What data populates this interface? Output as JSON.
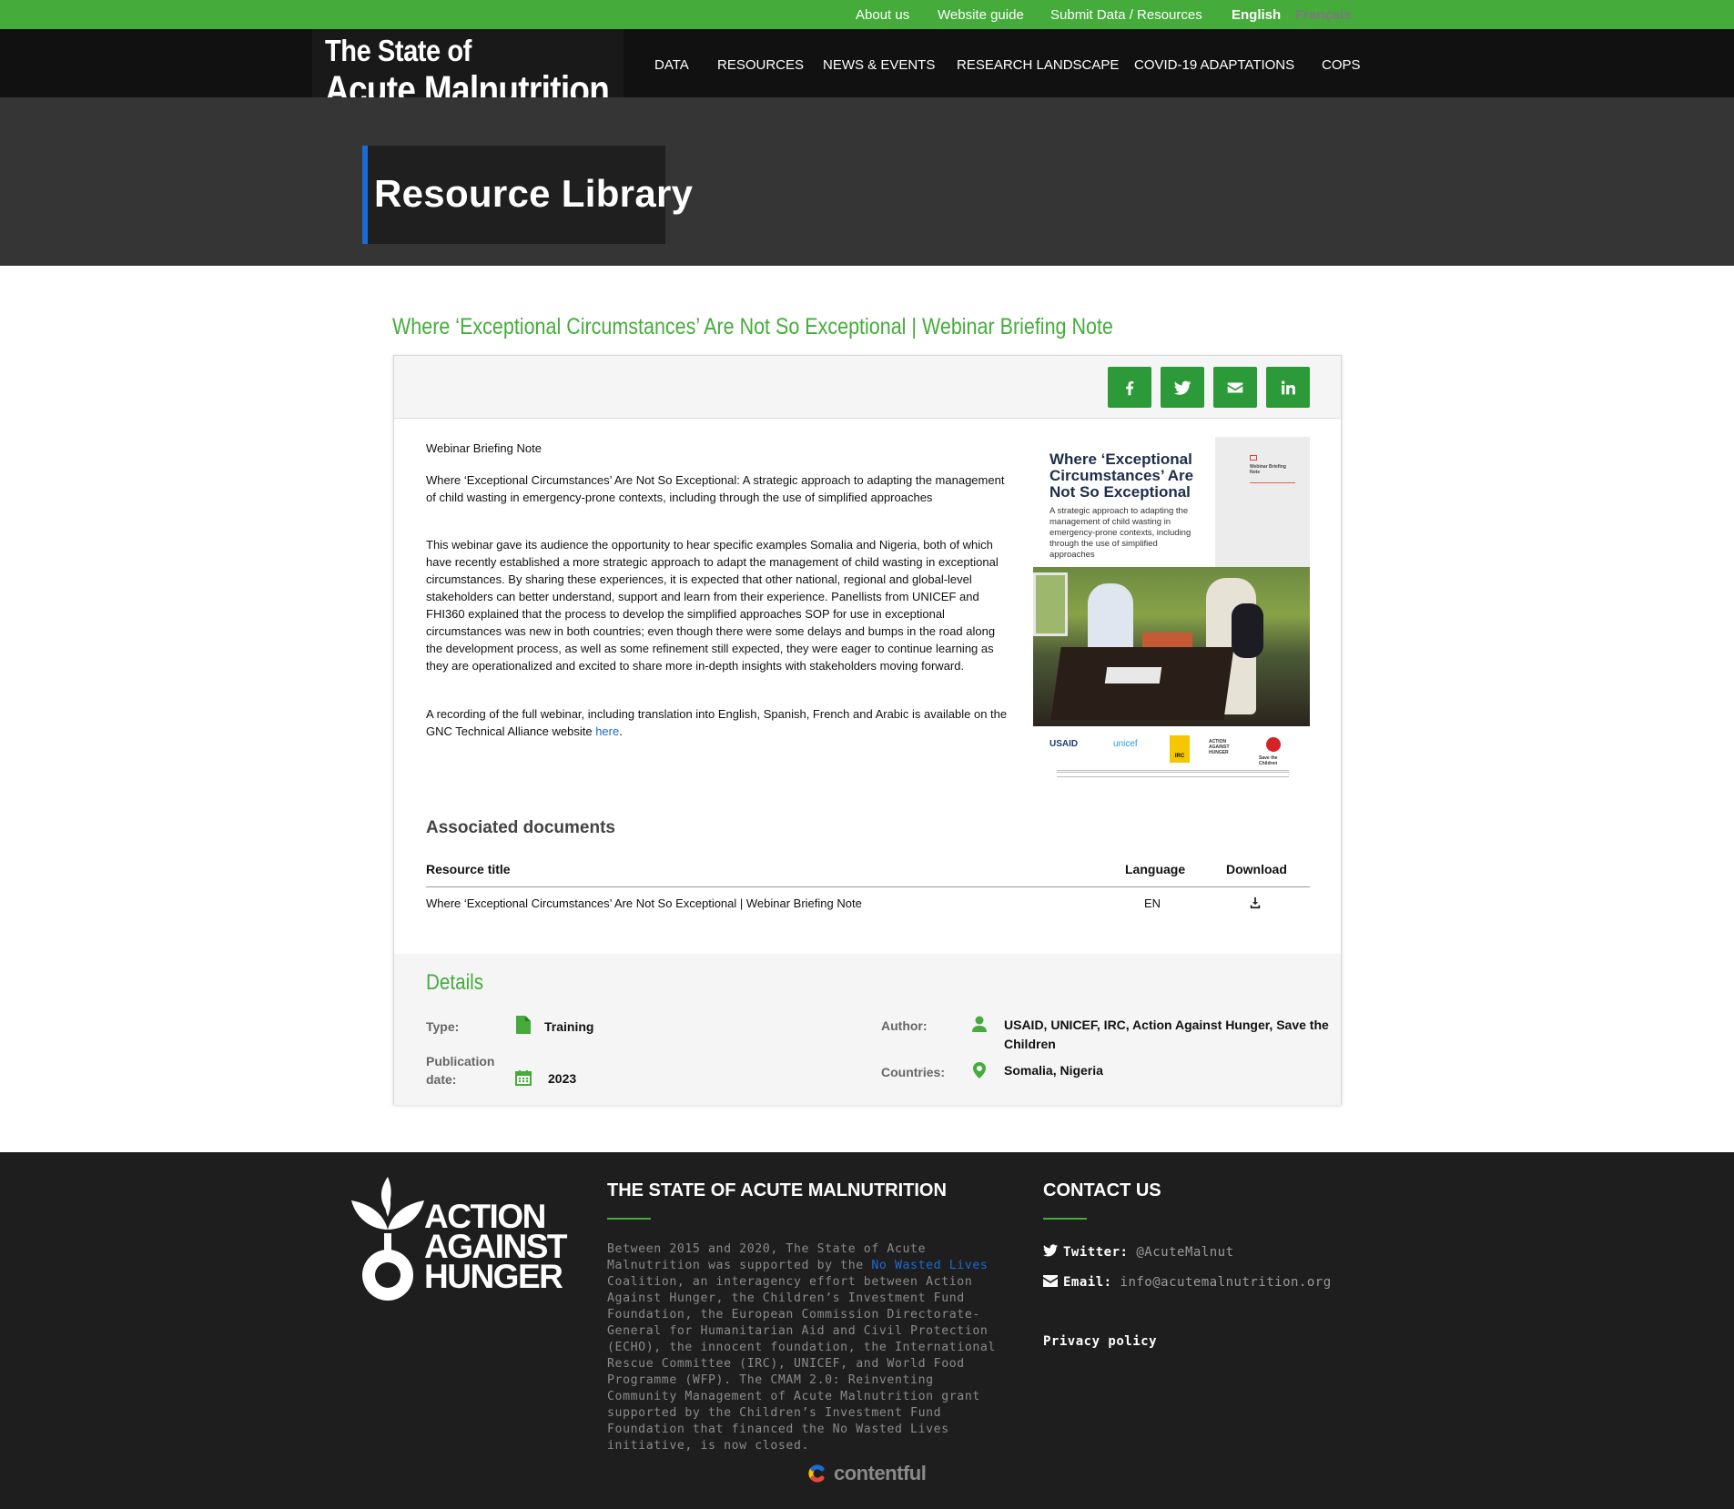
{
  "topbar": {
    "links": [
      "About us",
      "Website guide",
      "Submit Data / Resources"
    ],
    "lang_en": "English",
    "lang_fr": "Français"
  },
  "logo": {
    "line1": "The State of",
    "line2": "Acute Malnutrition"
  },
  "nav": [
    "DATA",
    "RESOURCES",
    "NEWS & EVENTS",
    "RESEARCH LANDSCAPE",
    "COVID-19 ADAPTATIONS",
    "COPS"
  ],
  "hero": {
    "title": "Resource Library"
  },
  "resource": {
    "title": "Where ‘Exceptional Circumstances’ Are Not So Exceptional | Webinar Briefing Note",
    "share_icons": [
      "facebook-icon",
      "twitter-icon",
      "email-icon",
      "linkedin-icon"
    ],
    "p1": "Webinar Briefing Note",
    "p2": "Where ‘Exceptional Circumstances’ Are Not So Exceptional: A strategic approach to adapting the management of child wasting in emergency-prone contexts, including through the use of simplified approaches",
    "p3": "This webinar gave its audience the opportunity to hear specific examples Somalia and Nigeria, both of which have recently established a more strategic approach to adapt the management of child wasting in exceptional circumstances. By sharing these experiences, it is expected that other national, regional and global-level stakeholders can better understand, support and learn from their experience. Panellists from UNICEF and FHI360 explained that the process to develop the simplified approaches SOP for use in exceptional circumstances was new in both countries; even though there were some delays and bumps in the road along the development process, as well as some refinement still expected, they were eager to continue learning as they are operationalized and excited to share more in-depth insights with stakeholders moving forward.",
    "p4_before": "A recording of the full webinar, including translation into English, Spanish, French and Arabic is available on the GNC Technical Alliance website ",
    "p4_link": "here",
    "p4_after": ".",
    "cover": {
      "title": "Where ‘Exceptional Circumstances’ Are Not So Exceptional",
      "subtitle": "A strategic approach to adapting the management of child wasting in emergency-prone contexts, including through the use of simplified approaches",
      "badge": "Webinar Briefing Note",
      "logos": [
        "USAID",
        "unicef",
        "IRC",
        "ACTION AGAINST HUNGER",
        "Save the Children"
      ]
    }
  },
  "associated": {
    "heading": "Associated documents",
    "col_title": "Resource title",
    "col_lang": "Language",
    "col_dl": "Download",
    "rows": [
      {
        "title": "Where ‘Exceptional Circumstances’ Are Not So Exceptional | Webinar Briefing Note",
        "lang": "EN"
      }
    ]
  },
  "details": {
    "heading": "Details",
    "type_label": "Type:",
    "type_value": "Training",
    "pub_label_1": "Publication",
    "pub_label_2": "date:",
    "pub_value": "2023",
    "author_label": "Author:",
    "author_value_1": "USAID, UNICEF, IRC, Action Against Hunger, Save the",
    "author_value_2": "Children",
    "countries_label": "Countries:",
    "countries_value": "Somalia, Nigeria"
  },
  "footer": {
    "aah": [
      "ACTION",
      "AGAINST",
      "HUNGER"
    ],
    "about_heading": "THE STATE OF ACUTE MALNUTRITION",
    "about_before": "Between 2015 and 2020, The State of Acute Malnutrition was supported by the ",
    "about_link": "No Wasted Lives",
    "about_after": " Coalition, an interagency effort between Action Against Hunger, the Children’s Investment Fund Foundation, the European Commission Directorate-General for Humanitarian Aid and Civil Protection (ECHO), the innocent foundation, the International Rescue Committee (IRC), UNICEF, and World Food Programme (WFP). The CMAM 2.0: Reinventing Community Management of Acute Malnutrition grant supported by the Children’s Investment Fund Foundation that financed the No Wasted Lives initiative, is now closed.",
    "contact_heading": "CONTACT US",
    "twitter_label": "Twitter:",
    "twitter_value": "@AcuteMalnut",
    "email_label": "Email:",
    "email_value": "info@acutemalnutrition.org",
    "privacy": "Privacy policy",
    "powered": "contentful"
  },
  "colors": {
    "green": "#45ac3b",
    "button_green": "#2d9a3a",
    "blue": "#1a6bd3"
  }
}
